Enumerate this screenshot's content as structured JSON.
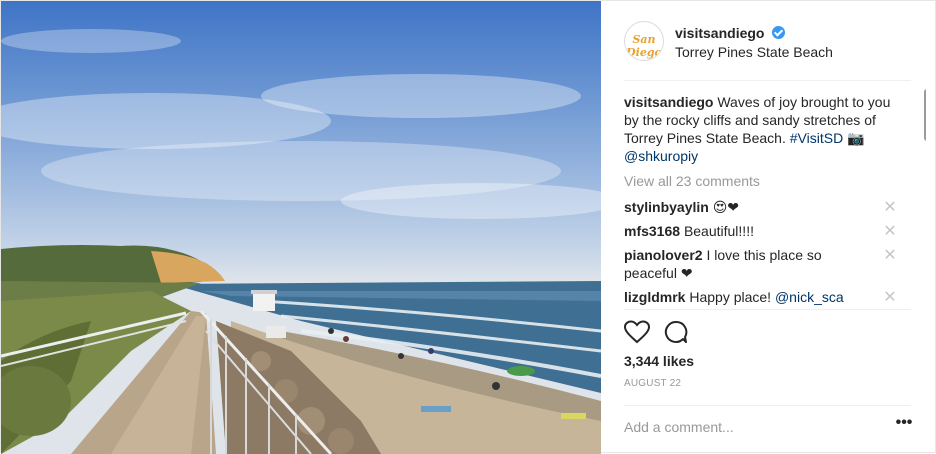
{
  "post": {
    "username": "visitsandiego",
    "location": "Torrey Pines State Beach",
    "avatar_text": "San Diego",
    "verified": true,
    "caption": {
      "author": "visitsandiego",
      "text": "Waves of joy brought to you by the rocky cliffs and sandy stretches of Torrey Pines State Beach.",
      "hashtag": "#VisitSD",
      "camera_emoji": "📷",
      "mention": "@shkuropiy"
    },
    "view_all": "View all 23 comments",
    "comments": [
      {
        "user": "stylinbyaylin",
        "text": "😍❤"
      },
      {
        "user": "mfs3168",
        "text": "Beautiful!!!!"
      },
      {
        "user": "pianolover2",
        "text": "I love this place so peaceful ❤"
      },
      {
        "user": "lizgldmrk",
        "text": "Happy place!",
        "mention": "@nick_sca"
      }
    ],
    "likes": "3,344 likes",
    "date": "AUGUST 22",
    "add_comment_placeholder": "Add a comment...",
    "more_label": "•••"
  },
  "icons": {
    "heart": "heart-icon",
    "comment": "comment-icon",
    "close": "close-icon",
    "verified": "verified-badge-icon",
    "more": "more-options-icon"
  },
  "colors": {
    "link": "#003569",
    "verified": "#3897f0",
    "muted": "#999999"
  }
}
